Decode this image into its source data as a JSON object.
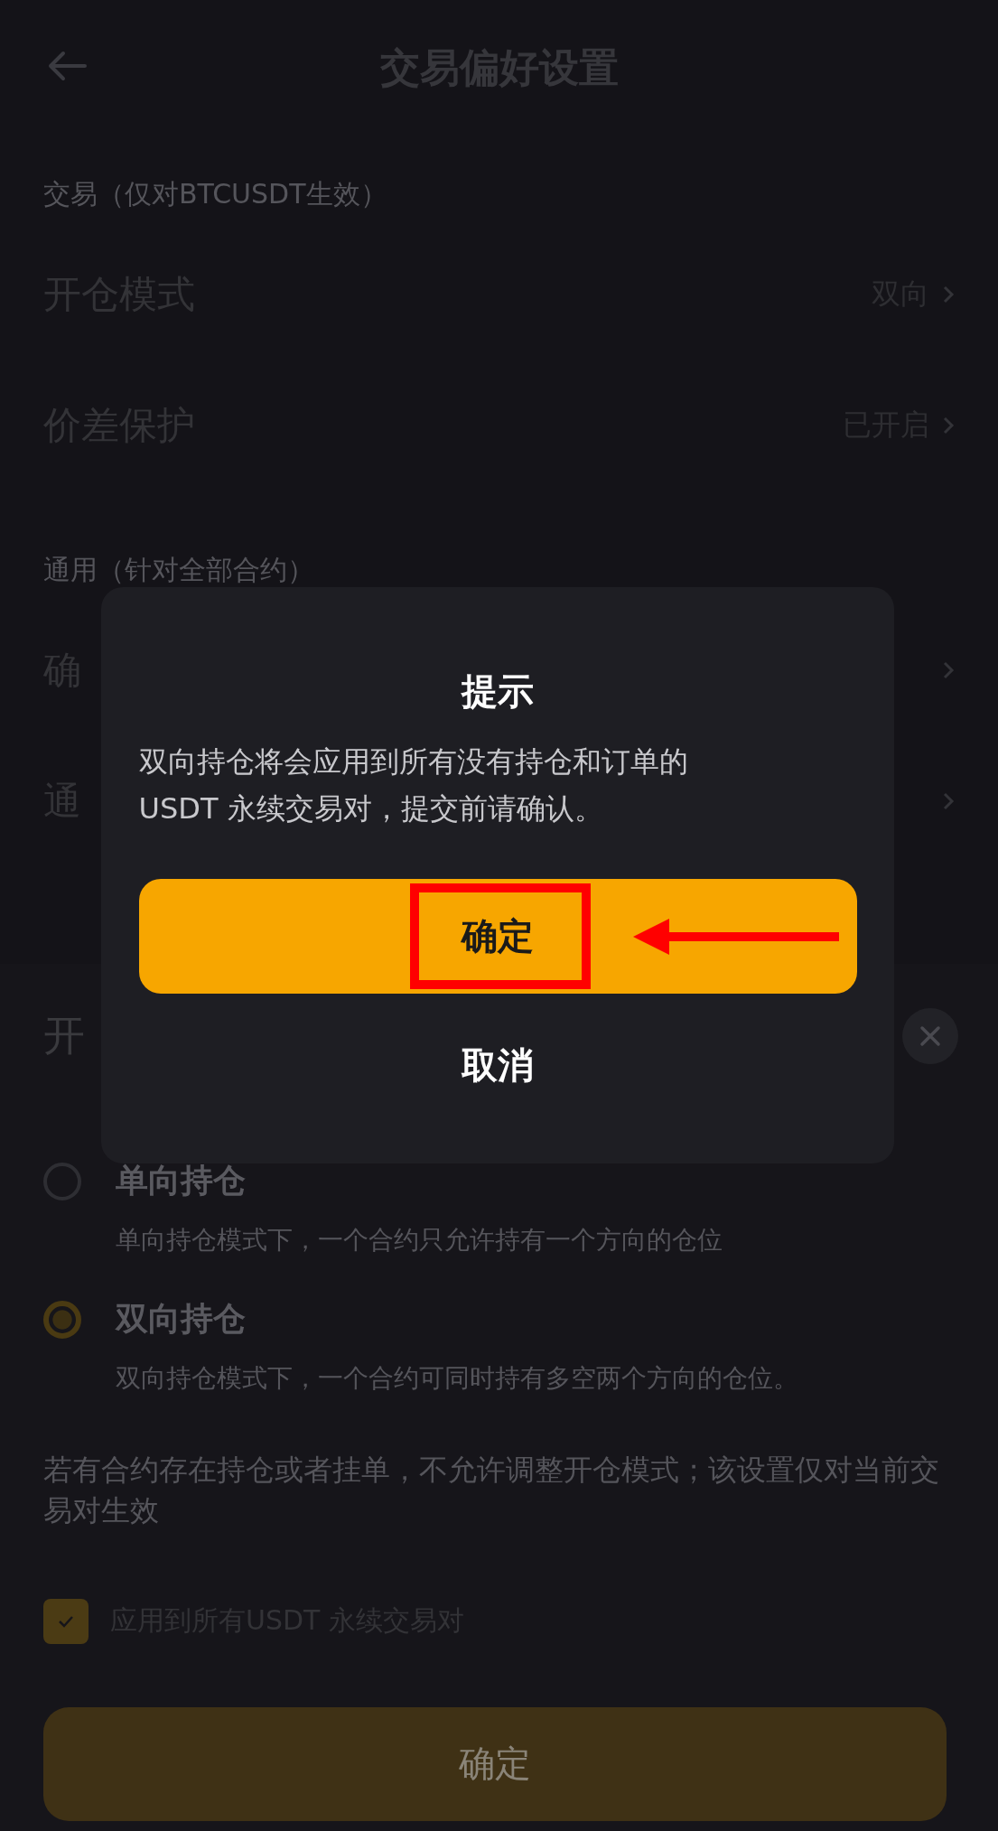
{
  "header": {
    "title": "交易偏好设置"
  },
  "sections": [
    {
      "label": "交易（仅对BTCUSDT生效）",
      "rows": [
        {
          "label": "开仓模式",
          "value": "双向"
        },
        {
          "label": "价差保护",
          "value": "已开启"
        }
      ]
    },
    {
      "label": "通用（针对全部合约）",
      "rows": [
        {
          "label": "确"
        },
        {
          "label": "通"
        }
      ]
    }
  ],
  "sheet": {
    "title": "开",
    "options": [
      {
        "label": "单向持仓",
        "description": "单向持仓模式下，一个合约只允许持有一个方向的仓位",
        "selected": false
      },
      {
        "label": "双向持仓",
        "description": "双向持仓模式下，一个合约可同时持有多空两个方向的仓位。",
        "selected": true
      }
    ],
    "note": "若有合约存在持仓或者挂单，不允许调整开仓模式；该设置仅对当前交易对生效",
    "apply_all": {
      "label": "应用到所有USDT 永续交易对",
      "checked": true
    },
    "confirm_button": "确定"
  },
  "dialog": {
    "title": "提示",
    "message": "双向持仓将会应用到所有没有持仓和订单的USDT 永续交易对，提交前请确认。",
    "confirm_button": "确定",
    "cancel_button": "取消"
  }
}
